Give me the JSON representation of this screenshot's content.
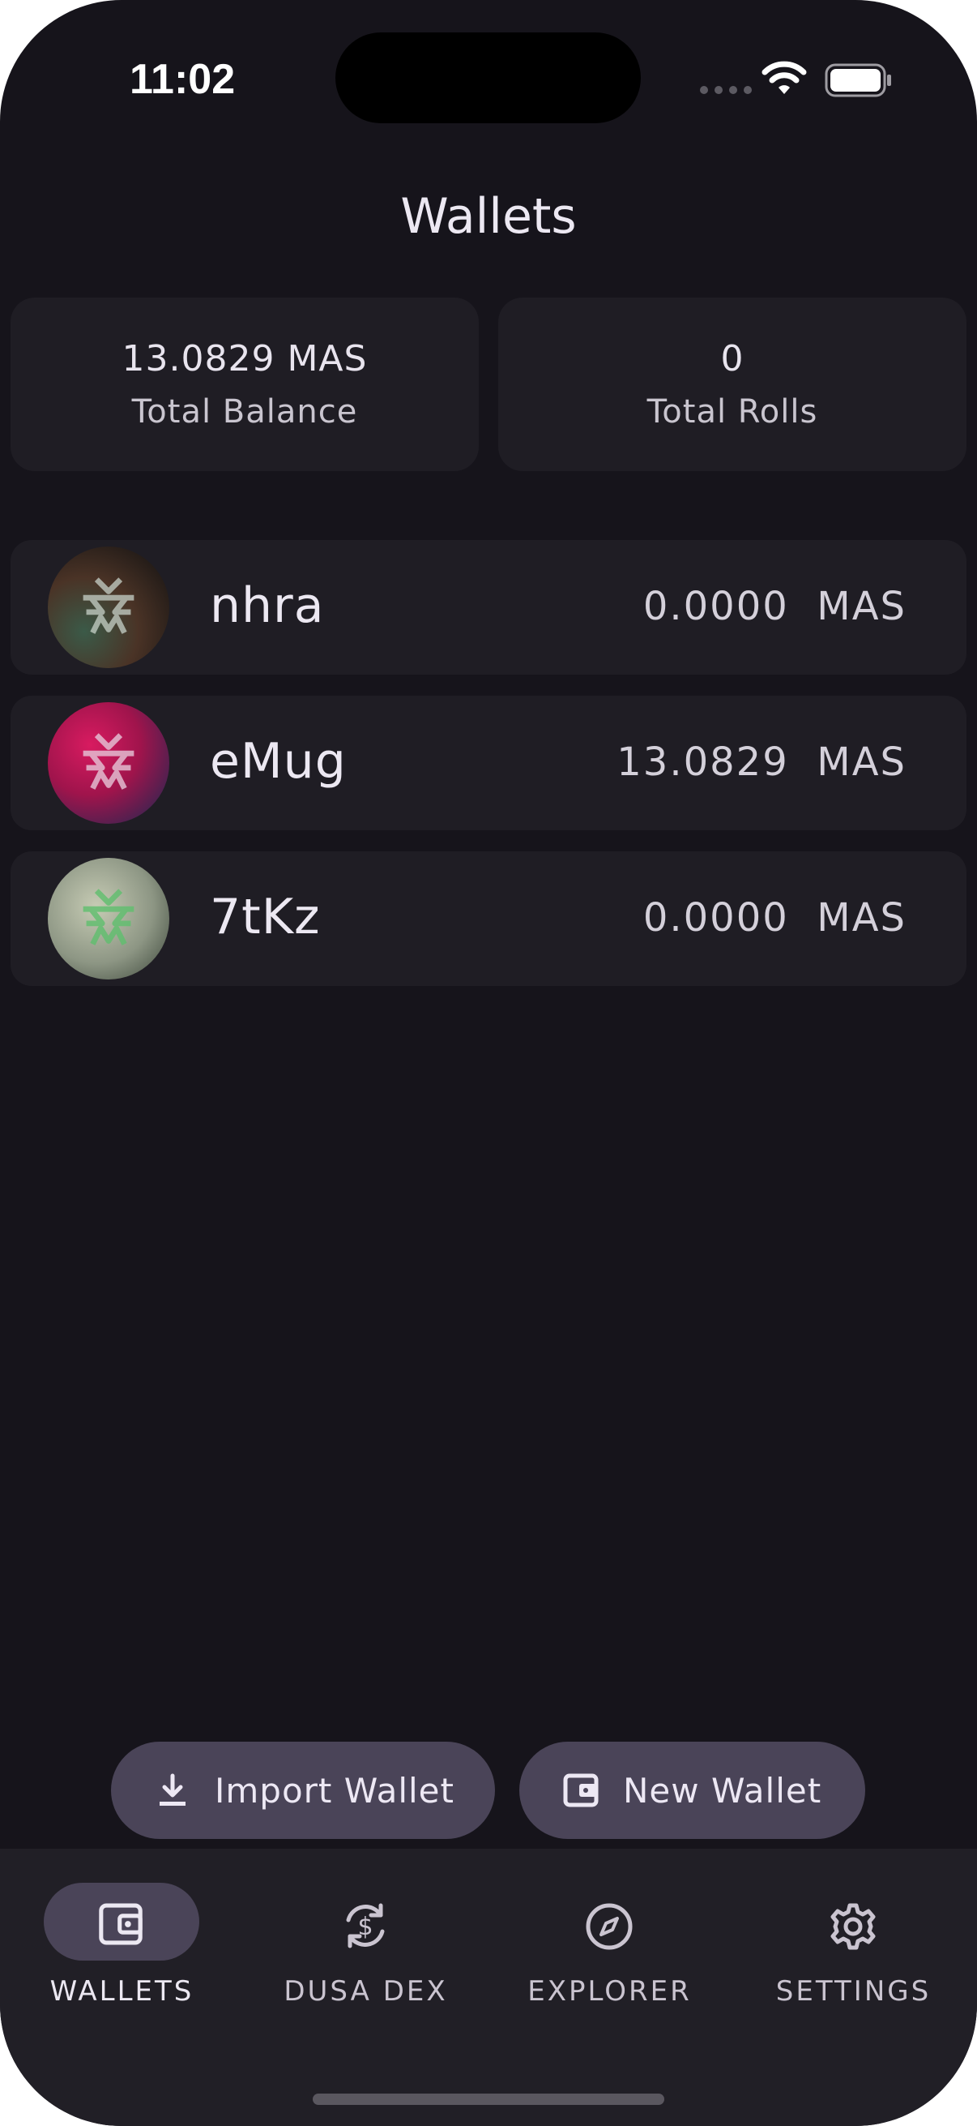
{
  "status_bar": {
    "time": "11:02"
  },
  "header": {
    "title": "Wallets"
  },
  "summary": {
    "total_balance_value": "13.0829 MAS",
    "total_balance_label": "Total Balance",
    "total_rolls_value": "0",
    "total_rolls_label": "Total Rolls"
  },
  "wallets": [
    {
      "name": "nhra",
      "balance": "0.0000  MAS",
      "avatar_colors": [
        "#2e2a26",
        "#6a3a22",
        "#3b5a48"
      ]
    },
    {
      "name": "eMug",
      "balance": "13.0829  MAS",
      "avatar_colors": [
        "#c2185b",
        "#7b1442",
        "#3a2a6a"
      ]
    },
    {
      "name": "7tKz",
      "balance": "0.0000  MAS",
      "avatar_colors": [
        "#b9c0a8",
        "#7e8876",
        "#4e5a48"
      ]
    }
  ],
  "actions": {
    "import_label": "Import Wallet",
    "new_label": "New Wallet"
  },
  "nav": {
    "items": [
      {
        "label": "WALLETS",
        "icon": "wallet-icon",
        "active": true
      },
      {
        "label": "DUSA DEX",
        "icon": "currency-exchange-icon",
        "active": false
      },
      {
        "label": "EXPLORER",
        "icon": "compass-icon",
        "active": false
      },
      {
        "label": "SETTINGS",
        "icon": "gear-icon",
        "active": false
      }
    ]
  },
  "colors": {
    "background": "#16141b",
    "card": "#1f1d24",
    "accent_pill": "#4a4458"
  }
}
